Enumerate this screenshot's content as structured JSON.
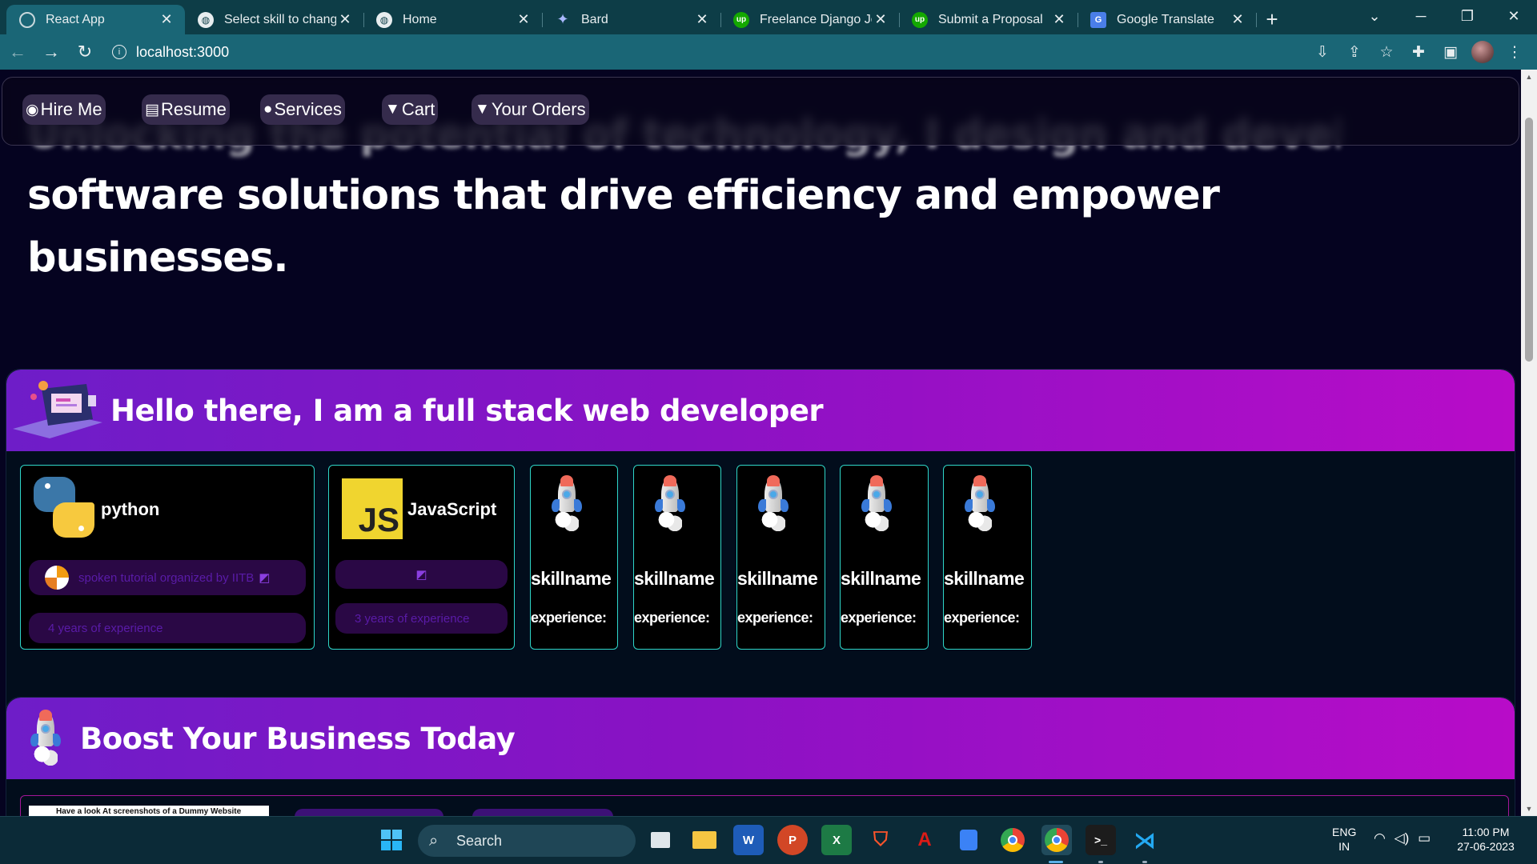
{
  "browser": {
    "tabs": [
      {
        "title": "React App",
        "favicon": "react-icon",
        "active": true
      },
      {
        "title": "Select skill to change | ",
        "favicon": "globe-icon",
        "active": false
      },
      {
        "title": "Home",
        "favicon": "globe-icon",
        "active": false
      },
      {
        "title": "Bard",
        "favicon": "bard-icon",
        "active": false
      },
      {
        "title": "Freelance Django Job",
        "favicon": "upwork-icon",
        "active": false
      },
      {
        "title": "Submit a Proposal",
        "favicon": "upwork-icon",
        "active": false
      },
      {
        "title": "Google Translate",
        "favicon": "google-translate-icon",
        "active": false
      }
    ],
    "url": "localhost:3000"
  },
  "page": {
    "hero_blurred": "Unlocking the potential of technology, I design and develop",
    "hero_line2": "software solutions that drive efficiency and empower",
    "hero_line3": "businesses.",
    "nav": [
      {
        "label": "Hire Me",
        "icon": "user-circle-icon"
      },
      {
        "label": "Resume",
        "icon": "document-icon"
      },
      {
        "label": "Services",
        "icon": "fire-icon"
      },
      {
        "label": "Cart",
        "icon": "cart-icon"
      },
      {
        "label": "Your Orders",
        "icon": "cart-plus-icon"
      }
    ],
    "about_title": "Hello there, I am a full stack web developer",
    "skills": [
      {
        "name": "python",
        "source": "spoken tutorial organized by IITB",
        "experience": "4 years of experience"
      },
      {
        "name": "JavaScript",
        "source": "",
        "experience": "3 years of experience"
      }
    ],
    "placeholder_skill": {
      "name": "skillname",
      "experience": "experience:"
    },
    "placeholder_count": 5,
    "js_logo_text": "JS",
    "boost_title": "Boost Your Business Today",
    "dummy_caption": "Have a look At screenshots of a Dummy Website"
  },
  "taskbar": {
    "search_placeholder": "Search",
    "lang_top": "ENG",
    "lang_bottom": "IN",
    "time": "11:00 PM",
    "date": "27-06-2023"
  },
  "colors": {
    "banner_start": "#6e1dc8",
    "banner_end": "#b80cc8",
    "card_border": "#2fd6c8",
    "page_bg": "#050320"
  }
}
